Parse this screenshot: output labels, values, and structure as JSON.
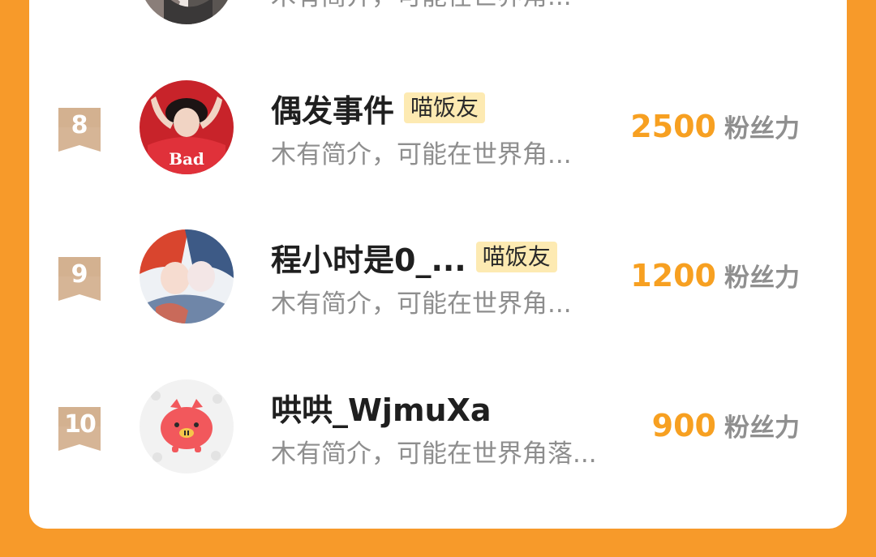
{
  "colors": {
    "background": "#f79a2a",
    "card": "#ffffff",
    "fans_number": "#f7a021",
    "badge_bg": "#fdeab2",
    "rank_flag": "#d9b89a"
  },
  "partial_row": {
    "intro": "木有简介，可能在世界角..."
  },
  "rows": [
    {
      "rank": "8",
      "name": "偶发事件",
      "badge": "喵饭友",
      "intro": "木有简介，可能在世界角...",
      "fans": "2500",
      "fans_label": "粉丝力",
      "avatar_icon": "girl-red-hoodie-avatar"
    },
    {
      "rank": "9",
      "name": "程小时是0_...",
      "badge": "喵饭友",
      "intro": "木有简介，可能在世界角...",
      "fans": "1200",
      "fans_label": "粉丝力",
      "avatar_icon": "anime-couple-avatar"
    },
    {
      "rank": "10",
      "name": "哄哄_WjmuXa",
      "intro": "木有简介，可能在世界角落...",
      "fans": "900",
      "fans_label": "粉丝力",
      "avatar_icon": "pink-pig-avatar"
    }
  ]
}
